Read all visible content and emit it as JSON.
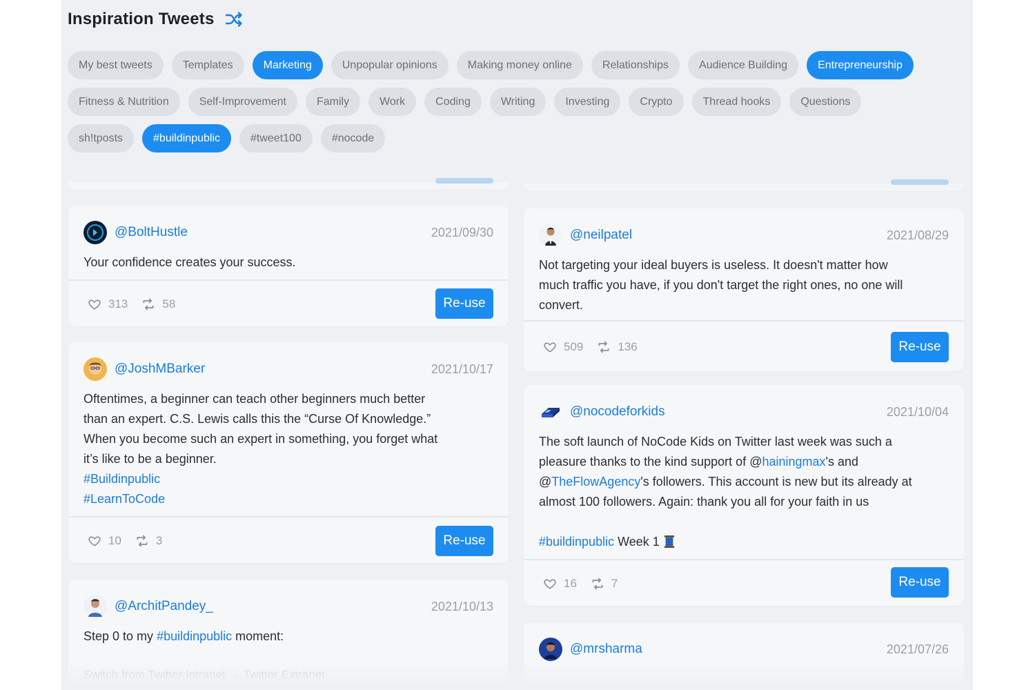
{
  "header": {
    "title": "Inspiration Tweets",
    "shuffle_icon": "shuffle-icon"
  },
  "chips": [
    [
      {
        "label": "My best tweets",
        "active": false
      },
      {
        "label": "Templates",
        "active": false
      },
      {
        "label": "Marketing",
        "active": true
      },
      {
        "label": "Unpopular opinions",
        "active": false
      },
      {
        "label": "Making money online",
        "active": false
      },
      {
        "label": "Relationships",
        "active": false
      },
      {
        "label": "Audience Building",
        "active": false
      },
      {
        "label": "Entrepreneurship",
        "active": true
      }
    ],
    [
      {
        "label": "Fitness & Nutrition",
        "active": false
      },
      {
        "label": "Self-Improvement",
        "active": false
      },
      {
        "label": "Family",
        "active": false
      },
      {
        "label": "Work",
        "active": false
      },
      {
        "label": "Coding",
        "active": false
      },
      {
        "label": "Writing",
        "active": false
      },
      {
        "label": "Investing",
        "active": false
      },
      {
        "label": "Crypto",
        "active": false
      },
      {
        "label": "Thread hooks",
        "active": false
      },
      {
        "label": "Questions",
        "active": false
      }
    ],
    [
      {
        "label": "sh!tposts",
        "active": false
      },
      {
        "label": "#buildinpublic",
        "active": true
      },
      {
        "label": "#tweet100",
        "active": false
      },
      {
        "label": "#nocode",
        "active": false
      }
    ]
  ],
  "tweets": {
    "boltHustle": {
      "handle": "@BoltHustle",
      "date": "2021/09/30",
      "text": "Your confidence creates your success.",
      "likes": "313",
      "retweets": "58",
      "reuse_label": "Re-use"
    },
    "joshMBarker": {
      "handle": "@JoshMBarker",
      "date": "2021/10/17",
      "lines": [
        "Oftentimes, a beginner can teach other beginners much better",
        "than an expert. C.S. Lewis calls this the “Curse Of Knowledge.”",
        "When you become such an expert in something, you forget what",
        "it’s like to be a beginner."
      ],
      "tags": [
        "#Buildinpublic",
        "#LearnToCode"
      ],
      "likes": "10",
      "retweets": "3",
      "reuse_label": "Re-use"
    },
    "architPandey": {
      "handle": "@ArchitPandey_",
      "date": "2021/10/13",
      "text_before": "Step 0 to my ",
      "tag": "#buildinpublic",
      "text_after": " moment:",
      "faded_line": "Switch from Twitter Intranet → Twitter Extranet"
    },
    "neilpatel": {
      "handle": "@neilpatel",
      "date": "2021/08/29",
      "lines": [
        "Not targeting your ideal buyers is useless. It doesn't matter how",
        "much traffic you have,  if you don't target the right ones, no one will",
        "convert."
      ],
      "likes": "509",
      "retweets": "136",
      "reuse_label": "Re-use"
    },
    "nocodeforkids": {
      "handle": "@nocodeforkids",
      "date": "2021/10/04",
      "line1": "The soft launch of NoCode Kids on Twitter last week was such a",
      "line2_before": "pleasure thanks to the kind support of @",
      "line2_mention": "hainingmax",
      "line2_after": "'s and",
      "line3_before": "@",
      "line3_mention": "TheFlowAgency",
      "line3_after": "'s followers. This account is new but its already at",
      "line4": "almost 100 followers. Again: thank you all for your faith in us",
      "tag": "#buildinpublic",
      "tag_after": " Week 1 ",
      "emoji_icon": "thread-spool-icon",
      "likes": "16",
      "retweets": "7",
      "reuse_label": "Re-use"
    },
    "mrsharma": {
      "handle": "@mrsharma",
      "date": "2021/07/26"
    }
  },
  "colors": {
    "accent": "#1d8cf0",
    "link": "#1a7de0",
    "chip": "#dde0e5",
    "panel": "#eef0f3"
  }
}
